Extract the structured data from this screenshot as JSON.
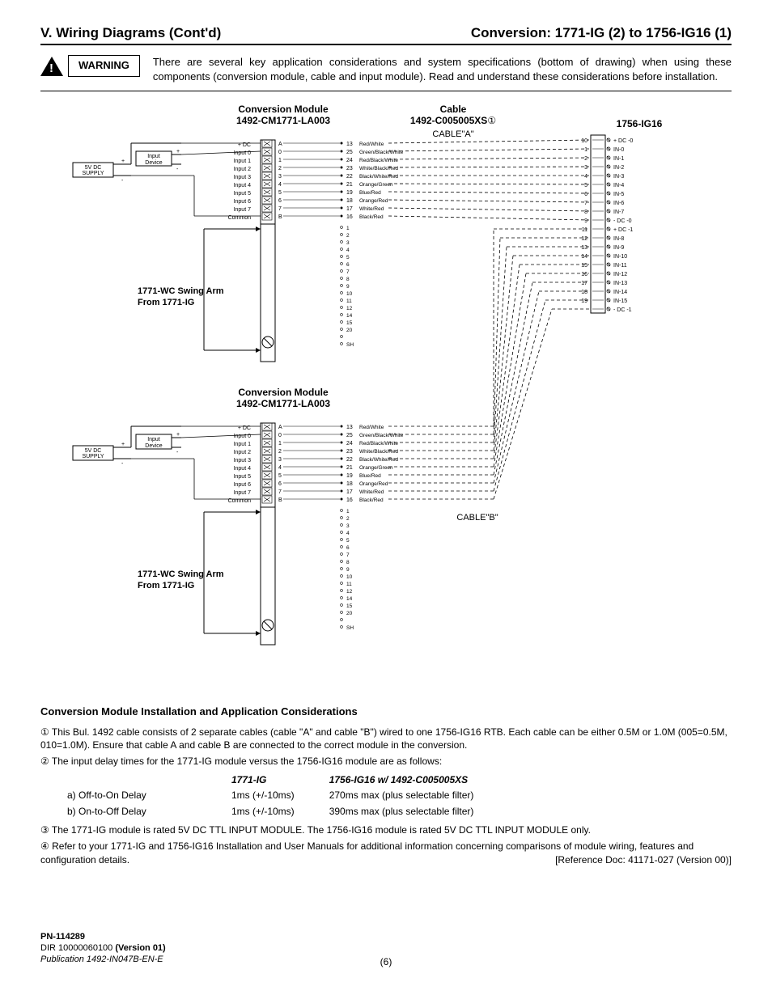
{
  "header": {
    "left": "V. Wiring Diagrams (Cont'd)",
    "right": "Conversion: 1771-IG (2) to 1756-IG16 (1)"
  },
  "warning": {
    "label": "WARNING",
    "text": "There are several key application considerations and system specifications (bottom of drawing) when using these components (conversion module, cable and input module). Read and understand these considerations before installation."
  },
  "diagram": {
    "conv_module_title": "Conversion Module",
    "conv_module_part": "1492-CM1771-LA003",
    "cable_title": "Cable",
    "cable_part": "1492-C005005XS",
    "cable_note_suffix": "①",
    "right_module": "1756-IG16",
    "cable_a": "CABLE\"A\"",
    "cable_b": "CABLE\"B\"",
    "swing_arm_line1": "1771-WC Swing Arm",
    "swing_arm_line2": "From 1771-IG",
    "supply": "5V DC SUPPLY",
    "input_device": "Input Device",
    "left_pins": [
      "+ DC",
      "Input 0",
      "Input 1",
      "Input 2",
      "Input 3",
      "Input 4",
      "Input 5",
      "Input 6",
      "Input 7",
      "Common"
    ],
    "term_letters": [
      "A",
      "0",
      "1",
      "2",
      "3",
      "4",
      "5",
      "6",
      "7",
      "B"
    ],
    "right_nums_a": [
      "13",
      "25",
      "24",
      "23",
      "22",
      "21",
      "19",
      "18",
      "17",
      "16"
    ],
    "wire_colors": [
      "Red/White",
      "Green/Black/White",
      "Red/Black/White",
      "White/Black/Red",
      "Black/White/Red",
      "Orange/Green",
      "Blue/Red",
      "Orange/Red",
      "White/Red",
      "Black/Red"
    ],
    "extra_terms": [
      "1",
      "2",
      "3",
      "4",
      "5",
      "6",
      "7",
      "8",
      "9",
      "10",
      "11",
      "12",
      "14",
      "15",
      "20",
      "",
      "SH"
    ],
    "ig16_pins": [
      {
        "n": "10",
        "lbl": "+ DC -0"
      },
      {
        "n": "1",
        "lbl": "IN-0"
      },
      {
        "n": "2",
        "lbl": "IN-1"
      },
      {
        "n": "3",
        "lbl": "IN-2"
      },
      {
        "n": "4",
        "lbl": "IN-3"
      },
      {
        "n": "5",
        "lbl": "IN-4"
      },
      {
        "n": "6",
        "lbl": "IN-5"
      },
      {
        "n": "7",
        "lbl": "IN-6"
      },
      {
        "n": "8",
        "lbl": "IN-7"
      },
      {
        "n": "9",
        "lbl": "- DC -0"
      },
      {
        "n": "11",
        "lbl": "+ DC -1"
      },
      {
        "n": "12",
        "lbl": "IN-8"
      },
      {
        "n": "13",
        "lbl": "IN-9"
      },
      {
        "n": "14",
        "lbl": "IN-10"
      },
      {
        "n": "15",
        "lbl": "IN-11"
      },
      {
        "n": "16",
        "lbl": "IN-12"
      },
      {
        "n": "17",
        "lbl": "IN-13"
      },
      {
        "n": "18",
        "lbl": "IN-14"
      },
      {
        "n": "19",
        "lbl": "IN-15"
      },
      {
        "n": "",
        "lbl": "- DC -1"
      }
    ]
  },
  "considerations": {
    "heading": "Conversion Module Installation and Application Considerations",
    "note1": "This Bul. 1492 cable consists of 2 separate cables (cable \"A\" and cable \"B\") wired to one 1756-IG16 RTB.  Each cable can be either 0.5M or 1.0M (005=0.5M, 010=1.0M).  Ensure that cable A and cable B are connected to the correct module in the conversion.",
    "note2_intro": "The input delay times for the 1771-IG module versus the 1756-IG16 module are as follows:",
    "delay_headers": [
      "",
      "1771-IG",
      "1756-IG16 w/ 1492-C005005XS"
    ],
    "delay_rows": [
      [
        "a) Off-to-On Delay",
        "1ms (+/-10ms)",
        "270ms max (plus selectable filter)"
      ],
      [
        "b) On-to-Off Delay",
        "1ms (+/-10ms)",
        "390ms max (plus selectable filter)"
      ]
    ],
    "note3": "The 1771-IG module is rated 5V DC TTL INPUT MODULE.  The 1756-IG16 module is rated 5V DC TTL INPUT MODULE only.",
    "note4": "Refer to your 1771-IG and 1756-IG16 Installation and User Manuals for additional information concerning comparisons of module wiring, features and configuration details.",
    "ref_doc": "[Reference Doc:  41171-027 (Version 00)]"
  },
  "footer": {
    "pn": "PN-114289",
    "dir": "DIR 10000060100 ",
    "version": "(Version 01)",
    "publication": "Publication 1492-IN047B-EN-E",
    "page": "(6)"
  },
  "circled": {
    "1": "①",
    "2": "②",
    "3": "③",
    "4": "④"
  }
}
